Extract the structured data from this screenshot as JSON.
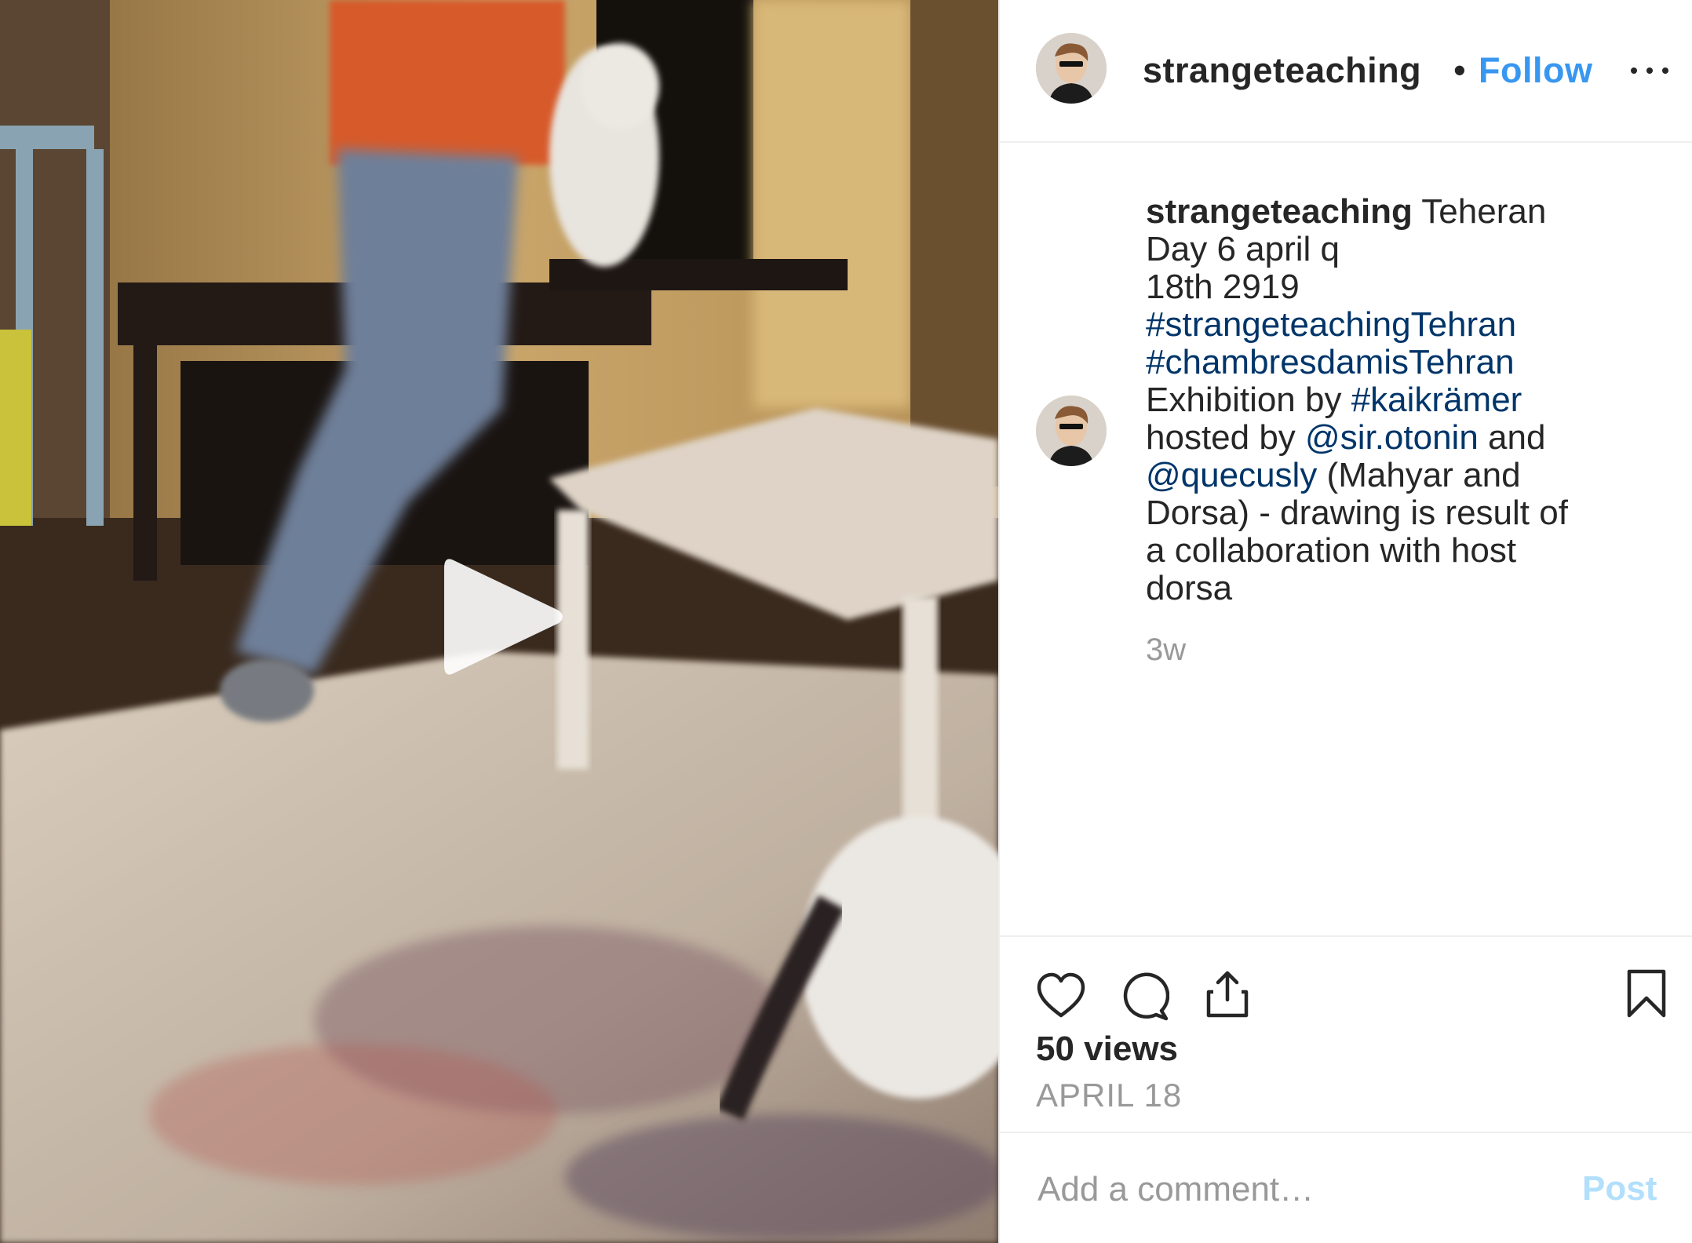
{
  "post": {
    "username": "strangeteaching",
    "dot": "•",
    "follow_label": "Follow",
    "more_icon": "more-options-icon"
  },
  "caption": {
    "username": "strangeteaching",
    "lines": [
      [
        {
          "t": " Teheran",
          "k": "text"
        }
      ],
      [
        {
          "t": "Day 6 april q",
          "k": "text"
        }
      ],
      [
        {
          "t": "18th 2919",
          "k": "text"
        }
      ],
      [
        {
          "t": "#strangeteachingTehran",
          "k": "tag"
        }
      ],
      [
        {
          "t": "#chambresdamisTehran",
          "k": "tag"
        }
      ],
      [
        {
          "t": "Exhibition by ",
          "k": "text"
        },
        {
          "t": "#kaikrämer",
          "k": "tag"
        }
      ],
      [
        {
          "t": "hosted by ",
          "k": "text"
        },
        {
          "t": "@sir.otonin",
          "k": "tag"
        },
        {
          "t": " and",
          "k": "text"
        }
      ],
      [
        {
          "t": "@quecusly",
          "k": "tag"
        },
        {
          "t": " (Mahyar and",
          "k": "text"
        }
      ],
      [
        {
          "t": "Dorsa) - drawing is result of",
          "k": "text"
        }
      ],
      [
        {
          "t": "a collaboration with host",
          "k": "text"
        }
      ],
      [
        {
          "t": "dorsa",
          "k": "text"
        }
      ]
    ],
    "time_ago": "3w"
  },
  "actions": {
    "icons": [
      "heart-icon",
      "comment-icon",
      "share-icon",
      "bookmark-icon"
    ],
    "views": "50 views",
    "date": "APRIL 18"
  },
  "comment_box": {
    "placeholder": "Add a comment…",
    "post_label": "Post"
  },
  "colors": {
    "link_blue": "#3897f0",
    "hashtag_blue": "#003569",
    "muted_gray": "#999999",
    "post_disabled": "#b2dffc"
  }
}
